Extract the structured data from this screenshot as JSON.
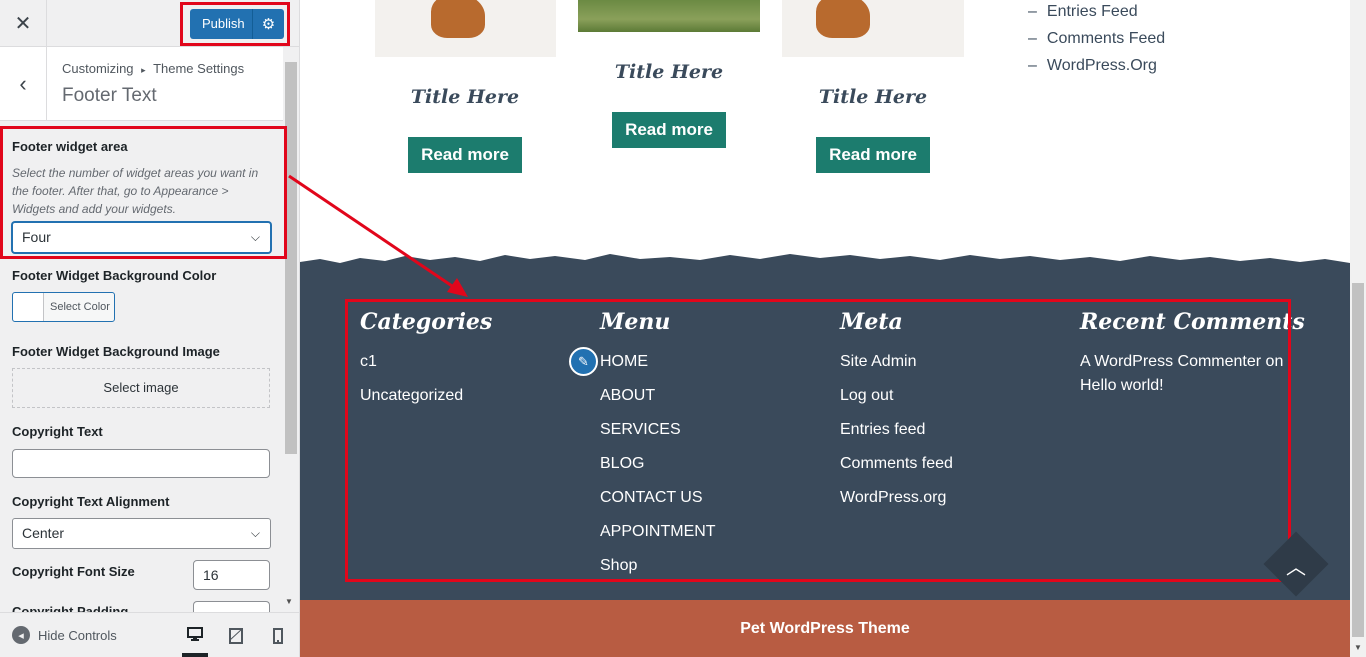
{
  "sidebar": {
    "close_label": "✕",
    "publish_label": "Publish",
    "breadcrumb_root": "Customizing",
    "breadcrumb_sep": "▸",
    "breadcrumb_section": "Theme Settings",
    "section_title": "Footer Text",
    "footer_widget_area": {
      "label": "Footer widget area",
      "description": "Select the number of widget areas you want in the footer. After that, go to Appearance > Widgets and add your widgets.",
      "selected": "Four"
    },
    "bg_color": {
      "label": "Footer Widget Background Color",
      "button_label": "Select Color"
    },
    "bg_image": {
      "label": "Footer Widget Background Image",
      "button_label": "Select image"
    },
    "copyright_text": {
      "label": "Copyright Text",
      "value": ""
    },
    "copyright_alignment": {
      "label": "Copyright Text Alignment",
      "selected": "Center"
    },
    "copyright_font_size": {
      "label": "Copyright Font Size",
      "value": "16"
    },
    "next_label_cut": "Copyright Padding",
    "hide_controls_label": "Hide Controls"
  },
  "preview": {
    "posts": [
      {
        "title": "Title Here",
        "button": "Read more"
      },
      {
        "title": "Title Here",
        "button": "Read more"
      },
      {
        "title": "Title Here",
        "button": "Read more"
      }
    ],
    "meta_links": [
      "Entries Feed",
      "Comments Feed",
      "WordPress.Org"
    ],
    "footer": {
      "categories": {
        "heading": "Categories",
        "items": [
          "c1",
          "Uncategorized"
        ]
      },
      "menu": {
        "heading": "Menu",
        "items": [
          "HOME",
          "ABOUT",
          "SERVICES",
          "BLOG",
          "CONTACT US",
          "APPOINTMENT",
          "Shop"
        ]
      },
      "meta": {
        "heading": "Meta",
        "items": [
          "Site Admin",
          "Log out",
          "Entries feed",
          "Comments feed",
          "WordPress.org"
        ]
      },
      "recent_comments": {
        "heading": "Recent Comments",
        "author": "A WordPress Commenter",
        "on": "on",
        "post": "Hello world!"
      }
    },
    "copyright": "Pet WordPress Theme"
  },
  "colors": {
    "publish_blue": "#2271b1",
    "footer_bg": "#3a4a5b",
    "button_teal": "#1c7c6e",
    "copyright_bg": "#b85c42",
    "highlight_red": "#e1061b"
  }
}
